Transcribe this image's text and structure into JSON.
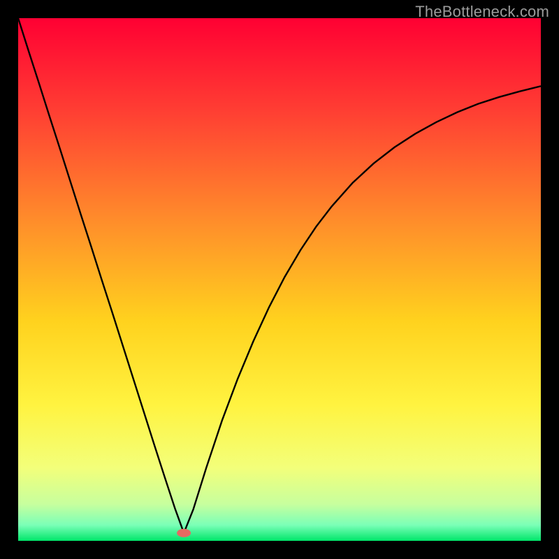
{
  "attribution": "TheBottleneck.com",
  "colors": {
    "frame": "#000000",
    "curve": "#000000",
    "marker": "#e46a62",
    "gradient_stops": [
      {
        "offset": 0.0,
        "color": "#ff0033"
      },
      {
        "offset": 0.18,
        "color": "#ff3f33"
      },
      {
        "offset": 0.38,
        "color": "#ff8a2b"
      },
      {
        "offset": 0.58,
        "color": "#ffd21e"
      },
      {
        "offset": 0.74,
        "color": "#fff340"
      },
      {
        "offset": 0.86,
        "color": "#f3ff7a"
      },
      {
        "offset": 0.93,
        "color": "#c7ff9e"
      },
      {
        "offset": 0.97,
        "color": "#7affb7"
      },
      {
        "offset": 1.0,
        "color": "#00e66a"
      }
    ]
  },
  "chart_data": {
    "type": "line",
    "title": "",
    "xlabel": "",
    "ylabel": "",
    "xlim": [
      0,
      1
    ],
    "ylim": [
      0,
      1
    ],
    "grid": false,
    "legend": false,
    "min_marker": {
      "x": 0.317,
      "y": 0.015
    },
    "series": [
      {
        "name": "bottleneck-curve",
        "x": [
          0.0,
          0.02,
          0.04,
          0.06,
          0.08,
          0.1,
          0.12,
          0.14,
          0.16,
          0.18,
          0.2,
          0.22,
          0.24,
          0.26,
          0.28,
          0.3,
          0.317,
          0.335,
          0.36,
          0.39,
          0.42,
          0.45,
          0.48,
          0.51,
          0.54,
          0.57,
          0.6,
          0.64,
          0.68,
          0.72,
          0.76,
          0.8,
          0.84,
          0.88,
          0.92,
          0.96,
          1.0
        ],
        "y": [
          1.0,
          0.937,
          0.875,
          0.812,
          0.75,
          0.687,
          0.624,
          0.562,
          0.499,
          0.437,
          0.374,
          0.311,
          0.248,
          0.185,
          0.123,
          0.062,
          0.015,
          0.06,
          0.14,
          0.23,
          0.31,
          0.382,
          0.447,
          0.505,
          0.556,
          0.601,
          0.64,
          0.685,
          0.722,
          0.753,
          0.779,
          0.801,
          0.82,
          0.836,
          0.849,
          0.86,
          0.87
        ]
      }
    ]
  }
}
